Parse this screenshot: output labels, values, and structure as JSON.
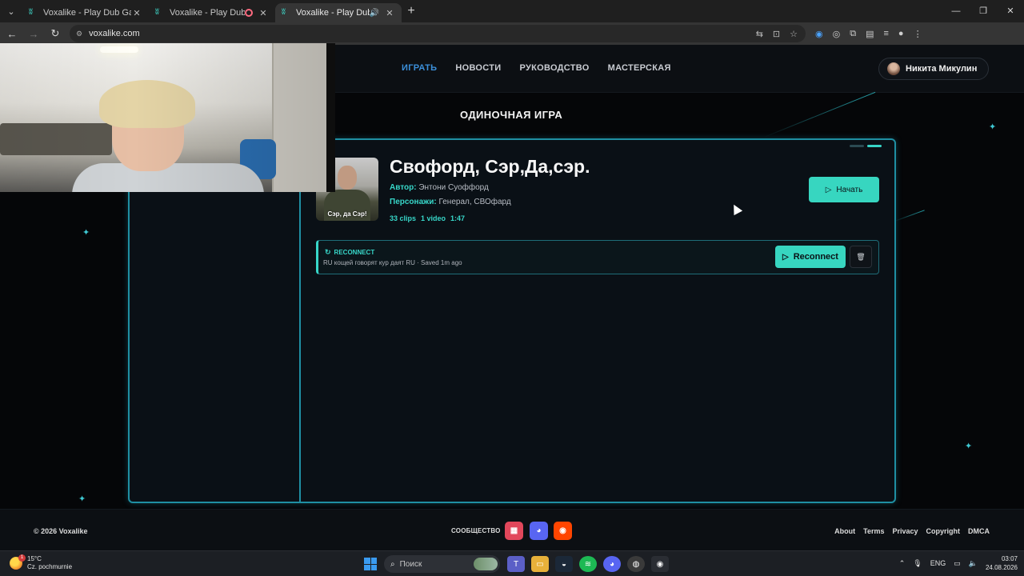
{
  "browser": {
    "tabs": [
      {
        "label": "Voxalike - Play Dub Game Onli",
        "active": false
      },
      {
        "label": "Voxalike - Play Dub Game C",
        "active": false
      },
      {
        "label": "Voxalike - Play Dub Game C",
        "active": true
      }
    ],
    "url": "voxalike.com"
  },
  "nav": {
    "items": [
      "ИГРАТЬ",
      "НОВОСТИ",
      "РУКОВОДСТВО",
      "МАСТЕРСКАЯ"
    ],
    "active": "ИГРАТЬ",
    "user": "Никита Микулин"
  },
  "section_title": "ОДИНОЧНАЯ ИГРА",
  "game": {
    "thumbnail_caption": "Сэр, да Сэр!",
    "title": "Свофорд, Сэр,Да,сэр.",
    "author_label": "Автор:",
    "author": "Энтони Суоффорд",
    "characters_label": "Персонажи:",
    "characters": "Генерал, СВОфард",
    "clips": "33 clips",
    "videos": "1 video",
    "duration": "1:47",
    "start_label": "Начать"
  },
  "save": {
    "tag": "RECONNECT",
    "description": "RU кощей говорят кур даят RU · Saved 1m ago",
    "reconnect_label": "Reconnect",
    "delete_icon": "trash-icon"
  },
  "footer": {
    "copyright": "© 2026 Voxalike",
    "community_label": "СООБЩЕСТВО",
    "links": [
      "About",
      "Terms",
      "Privacy",
      "Copyright",
      "DMCA"
    ]
  },
  "taskbar": {
    "weather_temp": "15°C",
    "weather_desc": "Cz. pochmurnie",
    "weather_badge": "1",
    "search_placeholder": "Поиск",
    "lang": "ENG",
    "time": "03:07",
    "date": "24.08.2026"
  },
  "colors": {
    "accent": "#37d6c8",
    "nav_active": "#3b8fd9",
    "frame_border": "#1f8fa3"
  }
}
